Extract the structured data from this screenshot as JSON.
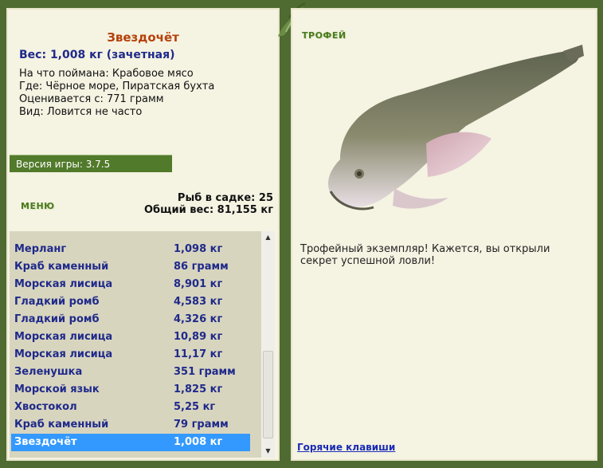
{
  "left": {
    "fish_name": "Звездочёт",
    "weight_line": "Вес: 1,008 кг (зачетная)",
    "info": [
      "На что поймана: Крабовое мясо",
      "Где: Чёрное море, Пиратская бухта",
      "Оценивается с: 771 грамм",
      "Вид: Ловится не часто"
    ],
    "version": "Версия игры: 3.7.5",
    "menu_label": "МЕНЮ",
    "stats": {
      "count": "Рыб в садке: 25",
      "total": "Общий вес: 81,155 кг"
    },
    "fish_list": [
      {
        "name": "Мерланг",
        "weight": "1,098 кг"
      },
      {
        "name": "Краб каменный",
        "weight": "86 грамм"
      },
      {
        "name": "Морская лисица",
        "weight": "8,901 кг"
      },
      {
        "name": "Гладкий ромб",
        "weight": "4,583 кг"
      },
      {
        "name": "Гладкий ромб",
        "weight": "4,326 кг"
      },
      {
        "name": "Морская лисица",
        "weight": "10,89 кг"
      },
      {
        "name": "Морская лисица",
        "weight": "11,17 кг"
      },
      {
        "name": "Зеленушка",
        "weight": "351 грамм"
      },
      {
        "name": "Морской язык",
        "weight": "1,825 кг"
      },
      {
        "name": "Хвостокол",
        "weight": "5,25 кг"
      },
      {
        "name": "Краб каменный",
        "weight": "79 грамм"
      },
      {
        "name": "Звездочёт",
        "weight": "1,008 кг",
        "selected": true
      }
    ]
  },
  "right": {
    "trophy_label": "ТРОФЕЙ",
    "trophy_text": "Трофейный экземпляр! Кажется, вы открыли секрет успешной ловли!",
    "hotkeys_link": "Горячие клавиши"
  },
  "colors": {
    "frame": "#4f6b32",
    "panel": "#f5f3e2",
    "fish_name": "#b5410b",
    "list_text": "#1f2a8a",
    "selected_row": "#3399ff",
    "version_bar": "#517a2a"
  },
  "icons": [
    "scroll-up-arrow-icon",
    "scroll-down-arrow-icon",
    "leaf-ornament-icon"
  ]
}
